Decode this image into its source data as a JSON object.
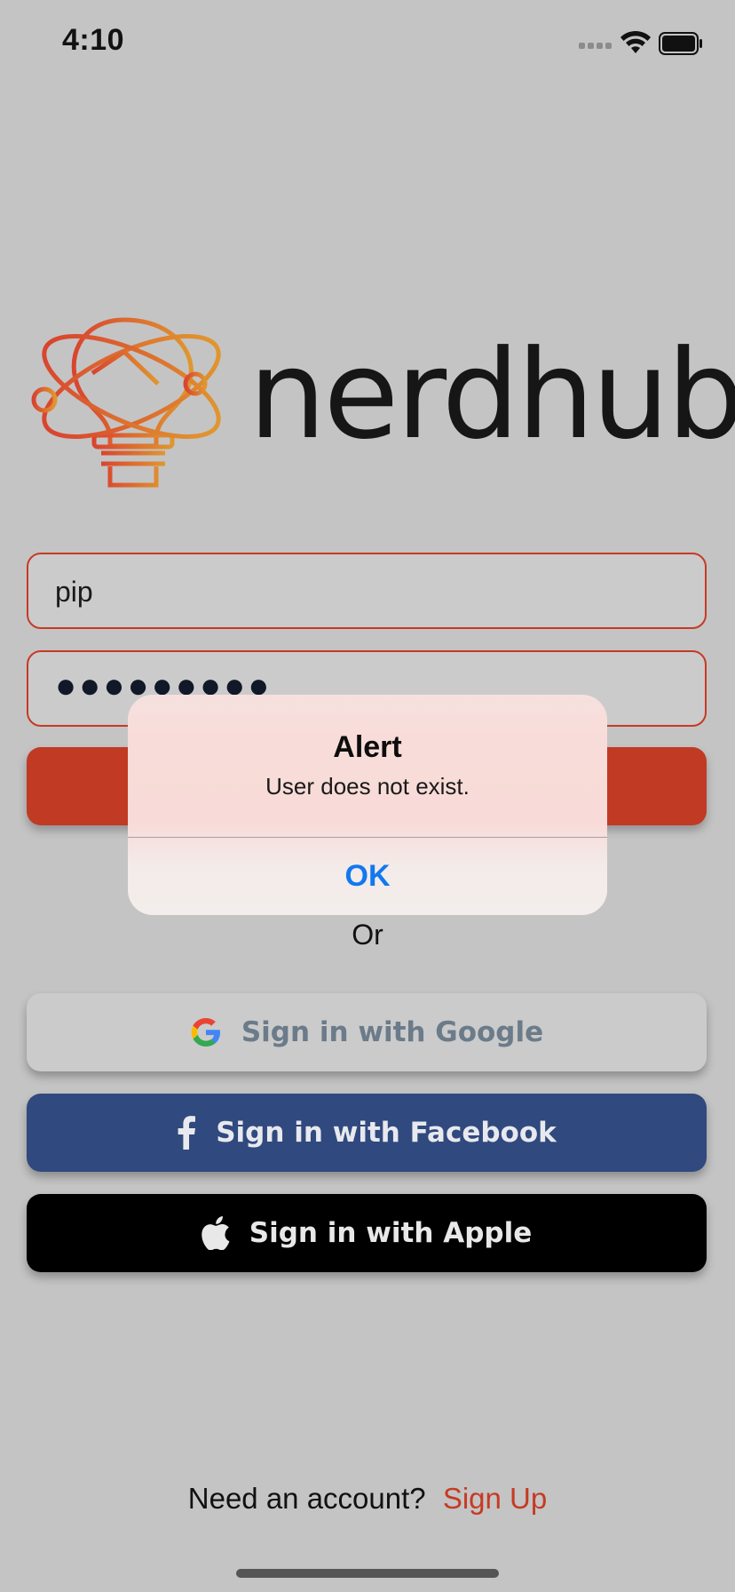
{
  "status_bar": {
    "time": "4:10"
  },
  "logo": {
    "wordmark": "nerdhub"
  },
  "login": {
    "username_value": "pip",
    "password_value": "●●●●●●●●●"
  },
  "divider_text": "Or",
  "social": {
    "google_label": "Sign in with Google",
    "facebook_label": "Sign in with Facebook",
    "apple_label": "Sign in with Apple"
  },
  "footer": {
    "prompt": "Need an account?",
    "signup_label": "Sign Up"
  },
  "alert": {
    "title": "Alert",
    "message": "User does not exist.",
    "ok_label": "OK"
  },
  "colors": {
    "accent": "#c63a24",
    "facebook": "#30497e",
    "apple": "#000000",
    "alert_button": "#1278ef"
  },
  "icons": [
    "signal-icon",
    "wifi-icon",
    "battery-icon",
    "lightbulb-logo-icon",
    "google-icon",
    "facebook-icon",
    "apple-icon"
  ]
}
